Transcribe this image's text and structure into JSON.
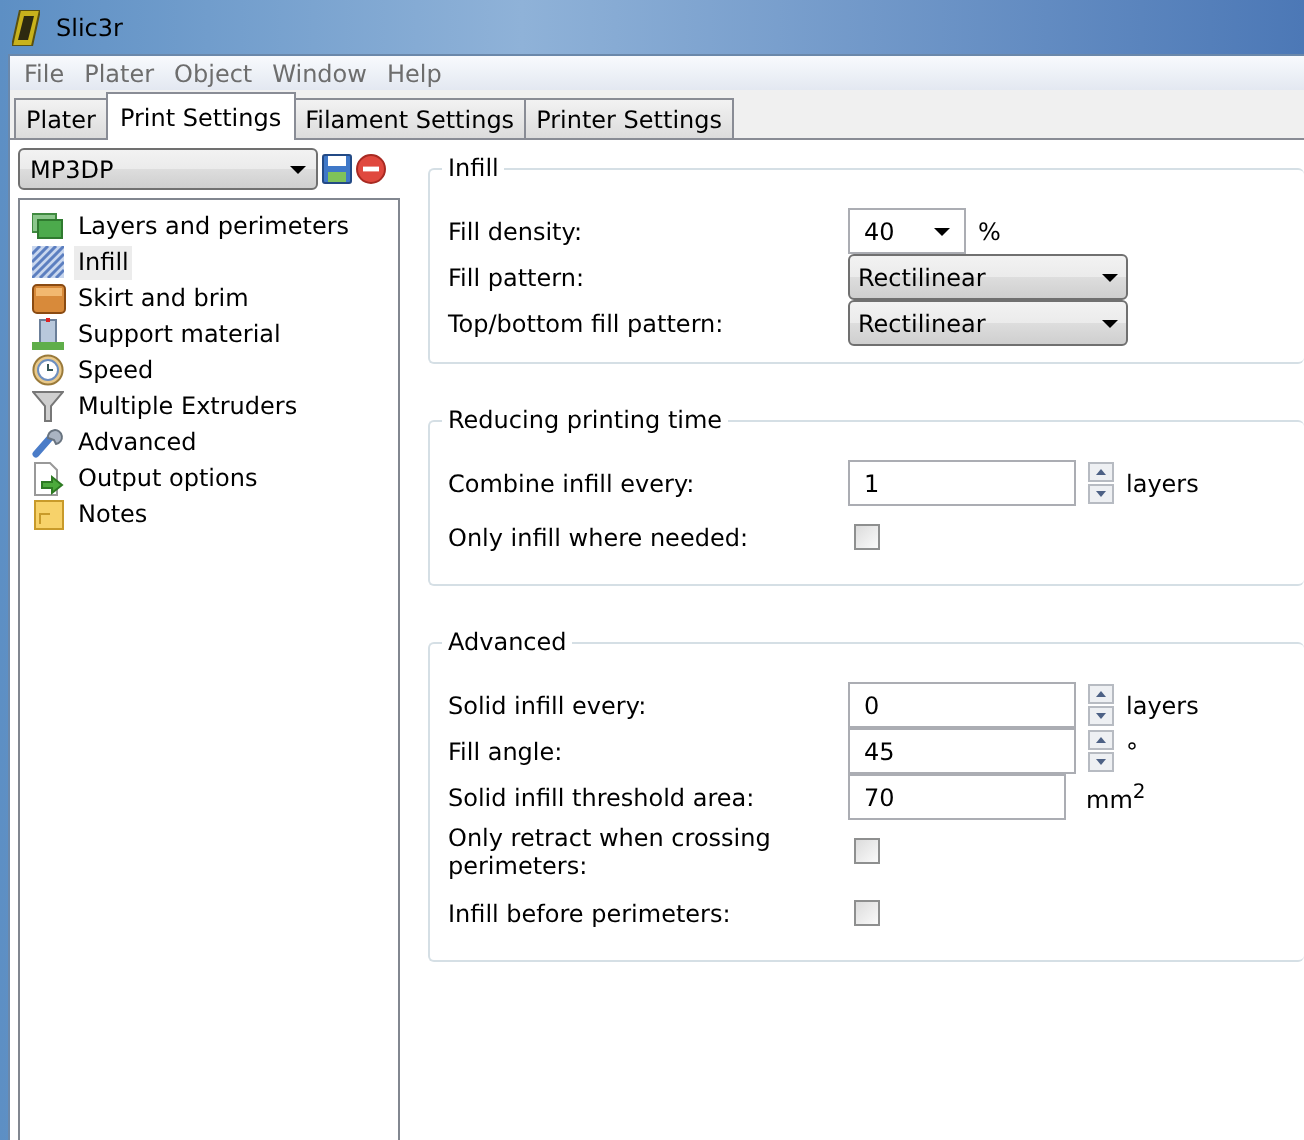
{
  "window": {
    "title": "Slic3r"
  },
  "menu": [
    "File",
    "Plater",
    "Object",
    "Window",
    "Help"
  ],
  "tabs": [
    {
      "label": "Plater",
      "selected": false
    },
    {
      "label": "Print Settings",
      "selected": true
    },
    {
      "label": "Filament Settings",
      "selected": false
    },
    {
      "label": "Printer Settings",
      "selected": false
    }
  ],
  "preset": {
    "value": "MP3DP"
  },
  "sidebar": {
    "items": [
      {
        "label": "Layers and perimeters",
        "selected": false
      },
      {
        "label": "Infill",
        "selected": true
      },
      {
        "label": "Skirt and brim",
        "selected": false
      },
      {
        "label": "Support material",
        "selected": false
      },
      {
        "label": "Speed",
        "selected": false
      },
      {
        "label": "Multiple Extruders",
        "selected": false
      },
      {
        "label": "Advanced",
        "selected": false
      },
      {
        "label": "Output options",
        "selected": false
      },
      {
        "label": "Notes",
        "selected": false
      }
    ]
  },
  "groups": [
    {
      "title": "Infill",
      "rows": [
        {
          "kind": "combo",
          "label": "Fill density:",
          "value": "40",
          "unit": "%"
        },
        {
          "kind": "select",
          "label": "Fill pattern:",
          "value": "Rectilinear"
        },
        {
          "kind": "select",
          "label": "Top/bottom fill pattern:",
          "value": "Rectilinear"
        }
      ]
    },
    {
      "title": "Reducing printing time",
      "rows": [
        {
          "kind": "spin",
          "label": "Combine infill every:",
          "value": "1",
          "unit": "layers"
        },
        {
          "kind": "checkbox",
          "label": "Only infill where needed:",
          "checked": false
        }
      ]
    },
    {
      "title": "Advanced",
      "rows": [
        {
          "kind": "spin",
          "label": "Solid infill every:",
          "value": "0",
          "unit": "layers"
        },
        {
          "kind": "spin",
          "label": "Fill angle:",
          "value": "45",
          "unit": "°"
        },
        {
          "kind": "text",
          "label": "Solid infill threshold area:",
          "value": "70",
          "unit": "mm$^{2}$"
        },
        {
          "kind": "checkbox",
          "label": "Only retract when crossing perimeters:",
          "checked": false
        },
        {
          "kind": "checkbox",
          "label": "Infill before perimeters:",
          "checked": false
        }
      ]
    }
  ]
}
